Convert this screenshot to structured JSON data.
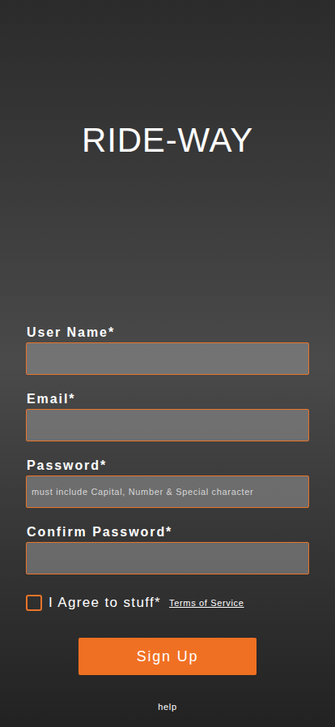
{
  "app": {
    "title": "RIDE-WAY"
  },
  "fields": [
    {
      "label": "User Name*",
      "placeholder": "",
      "type": "text"
    },
    {
      "label": "Email*",
      "placeholder": "",
      "type": "email"
    },
    {
      "label": "Password*",
      "placeholder": "must include Capital, Number & Special character",
      "type": "password"
    },
    {
      "label": "Confirm Password*",
      "placeholder": "",
      "type": "password"
    }
  ],
  "agree": {
    "label": "I Agree to stuff*",
    "checked": false,
    "link": "Terms of Service"
  },
  "buttons": [
    "Sign Up"
  ],
  "footer": {
    "help": "help"
  }
}
